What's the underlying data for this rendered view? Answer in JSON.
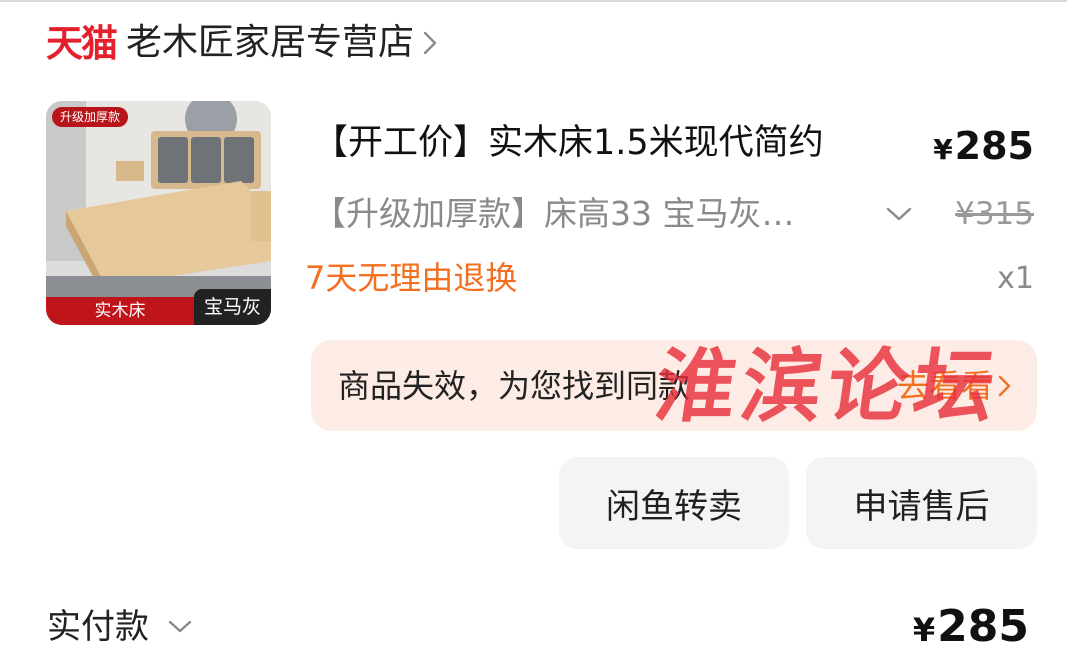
{
  "store": {
    "platform_logo": "天猫",
    "name": "老木匠家居专营店"
  },
  "item": {
    "thumbnail": {
      "tag": "升级加厚款",
      "left_label": "实木床",
      "right_label": "宝马灰"
    },
    "title": "【开工价】实木床1.5米现代简约",
    "price": "285",
    "currency": "¥",
    "spec": "【升级加厚款】床高33 宝马灰…",
    "original_price": "¥315",
    "return_policy": "7天无理由退换",
    "quantity": "x1"
  },
  "invalid_notice": {
    "text": "商品失效，为您找到同款",
    "action": "去看看"
  },
  "actions": {
    "xianyu_resell": "闲鱼转卖",
    "after_sale": "申请售后"
  },
  "payment": {
    "label": "实付款",
    "currency": "¥",
    "amount": "285"
  },
  "watermark": "淮滨论坛",
  "colors": {
    "brand_red": "#e5202d",
    "accent_orange": "#f2701f",
    "notice_bg": "#fdebe6",
    "button_bg": "#f3f4f6"
  }
}
